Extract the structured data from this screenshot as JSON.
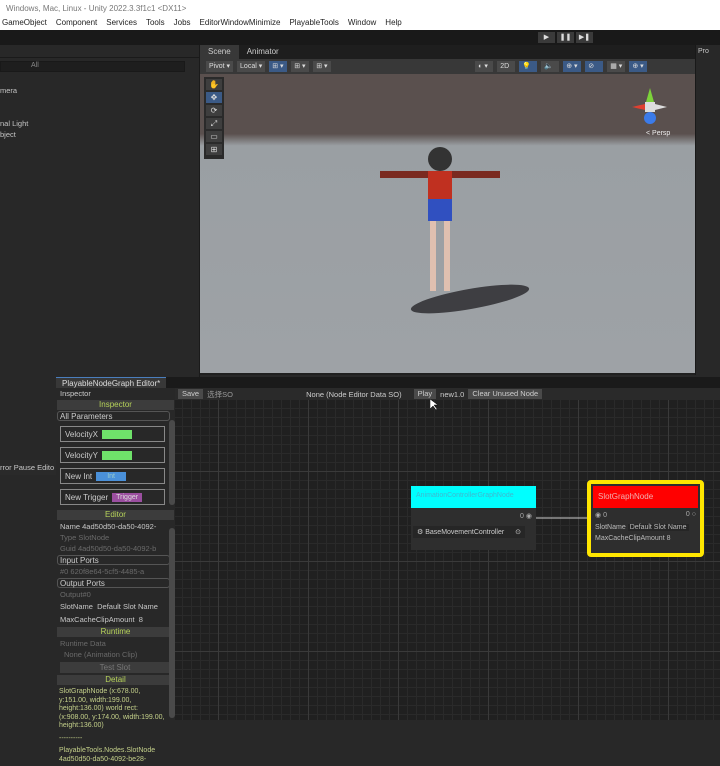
{
  "window": {
    "title": "Windows, Mac, Linux - Unity 2022.3.3f1c1 <DX11>"
  },
  "menu": [
    "GameObject",
    "Component",
    "Services",
    "Tools",
    "Jobs",
    "EditorWindowMinimize",
    "PlayableTools",
    "Window",
    "Help"
  ],
  "play_controls": [
    "▶",
    "❚❚",
    "▶❚"
  ],
  "hierarchy": {
    "search_placeholder": "All",
    "items": [
      "mera",
      "",
      "",
      "nal Light",
      "bject"
    ]
  },
  "scene": {
    "tabs": [
      "Scene",
      "Animator"
    ],
    "toolbar": [
      "Pivot ▾",
      "Local ▾",
      "⊞ ▾",
      "⊞ ▾",
      "⊞ ▾"
    ],
    "right_toolbar": [
      "◐ ▾",
      "2D",
      "💡",
      "🔈",
      "⊕ ▾",
      "⊘",
      "▦ ▾",
      "⊕ ▾"
    ],
    "gizmo_label": "< Persp",
    "tools": [
      "✋",
      "✥",
      "⟳",
      "⤢",
      "▭",
      "⊞"
    ]
  },
  "project": {
    "tab": "Pro"
  },
  "console": {
    "text": "rror Pause  Edito"
  },
  "graph_editor": {
    "tab": "PlayableNodeGraph Editor*",
    "inspector_label": "Inspector",
    "toolbar": {
      "save": "Save",
      "select_so": "选择SO",
      "data_so": "None (Node Editor Data SO)",
      "play": "Play",
      "version": "new1.0",
      "clear": "Clear Unused Node"
    },
    "inspector": {
      "header": "Inspector",
      "all_parameters": "All Parameters",
      "params": [
        {
          "name": "VelocityX",
          "type": "Float",
          "color": "#6fe26a"
        },
        {
          "name": "VelocityY",
          "type": "Float",
          "color": "#6fe26a"
        },
        {
          "name": "New Int",
          "type": "Int",
          "color": "#4a90d9"
        },
        {
          "name": "New Trigger",
          "type": "Trigger",
          "color": "#9b4fa0"
        }
      ],
      "editor_header": "Editor",
      "name_label": "Name",
      "name_value": "4ad50d50-da50-4092-",
      "type_label": "Type",
      "type_value": "SlotNode",
      "guid_label": "Guid",
      "guid_value": "4ad50d50-da50-4092-b",
      "input_ports": "Input Ports",
      "input_port_value": "#0    620f8e64-5cf5-4485-a",
      "output_ports": "Output Ports",
      "output_port_value": "Output#0",
      "slot_name_label": "SlotName",
      "slot_name_value": "Default Slot Name",
      "max_cache_label": "MaxCacheClipAmount",
      "max_cache_value": "8",
      "runtime_header": "Runtime",
      "runtime_data": "Runtime Data",
      "clip_field": "None (Animation Clip)",
      "test_button": "Test Slot",
      "detail_header": "Detail",
      "detail_text": "SlotGraphNode  (x:678.00, y:151.00, width:199.00, height:136.00) world rect: (x:908.00, y:174.00, width:199.00, height:136.00)",
      "separator": "----------",
      "detail_text2": "PlayableTools.Nodes.SlotNode 4ad50d50-da50-4092-be28-"
    },
    "nodes": [
      {
        "title": "AnimationControllerGraphNode",
        "color": "#00ffff",
        "port_label": "0",
        "field": "BaseMovementController"
      },
      {
        "title": "SlotGraphNode",
        "color": "#ff0000",
        "in_port": "0",
        "out_port": "0",
        "slot_name_label": "SlotName",
        "slot_name": "Default Slot Name",
        "max_cache_label": "MaxCacheClipAmount",
        "max_cache": "8",
        "highlight": "#ffe600"
      }
    ]
  }
}
